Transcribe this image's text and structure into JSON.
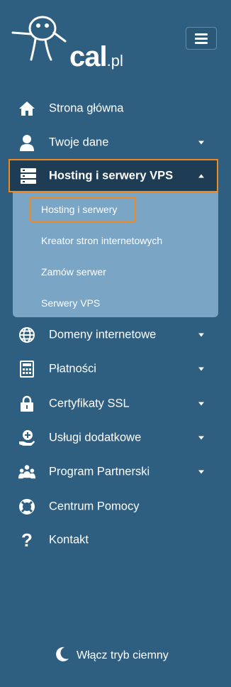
{
  "brand": {
    "logo_text": "cal",
    "logo_suffix": ".pl"
  },
  "header": {
    "menu_toggle": "hamburger-menu-icon"
  },
  "nav": {
    "items": [
      {
        "label": "Strona główna",
        "icon": "home-icon",
        "has_dropdown": false
      },
      {
        "label": "Twoje dane",
        "icon": "user-icon",
        "has_dropdown": true
      },
      {
        "label": "Hosting i serwery VPS",
        "icon": "server-icon",
        "has_dropdown": true,
        "expanded": true,
        "active": true
      },
      {
        "label": "Domeny internetowe",
        "icon": "globe-icon",
        "has_dropdown": true
      },
      {
        "label": "Płatności",
        "icon": "calculator-icon",
        "has_dropdown": true
      },
      {
        "label": "Certyfikaty SSL",
        "icon": "lock-icon",
        "has_dropdown": true
      },
      {
        "label": "Usługi dodatkowe",
        "icon": "add-service-icon",
        "has_dropdown": true
      },
      {
        "label": "Program Partnerski",
        "icon": "partners-icon",
        "has_dropdown": true
      },
      {
        "label": "Centrum Pomocy",
        "icon": "lifebuoy-icon",
        "has_dropdown": false
      },
      {
        "label": "Kontakt",
        "icon": "question-icon",
        "has_dropdown": false
      }
    ],
    "submenu": [
      {
        "label": "Hosting i serwery",
        "active": true
      },
      {
        "label": "Kreator stron internetowych"
      },
      {
        "label": "Zamów serwer"
      },
      {
        "label": "Serwery VPS"
      }
    ]
  },
  "footer": {
    "dark_mode_label": "Włącz tryb ciemny",
    "dark_mode_icon": "moon-icon"
  },
  "colors": {
    "background": "#2e5f80",
    "active_bg": "#1e3d55",
    "submenu_bg": "#7aa5c5",
    "highlight": "#ee8a1e"
  }
}
